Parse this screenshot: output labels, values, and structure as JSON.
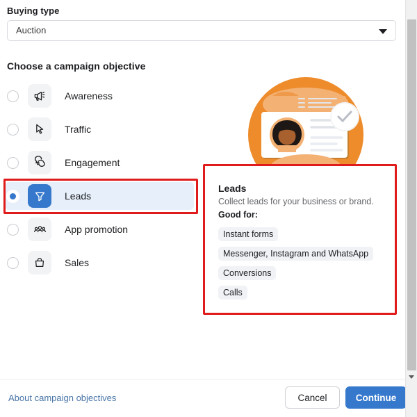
{
  "buying_type": {
    "label": "Buying type",
    "selected_value": "Auction",
    "caret_icon": "chevron-down-icon"
  },
  "section": {
    "title": "Choose a campaign objective"
  },
  "objectives": [
    {
      "id": "awareness",
      "label": "Awareness",
      "icon": "megaphone-icon",
      "selected": false
    },
    {
      "id": "traffic",
      "label": "Traffic",
      "icon": "cursor-arrow-icon",
      "selected": false
    },
    {
      "id": "engagement",
      "label": "Engagement",
      "icon": "chat-bubbles-icon",
      "selected": false
    },
    {
      "id": "leads",
      "label": "Leads",
      "icon": "funnel-icon",
      "selected": true
    },
    {
      "id": "app-promotion",
      "label": "App promotion",
      "icon": "people-group-icon",
      "selected": false
    },
    {
      "id": "sales",
      "label": "Sales",
      "icon": "shopping-bag-icon",
      "selected": false
    }
  ],
  "detail": {
    "title": "Leads",
    "description": "Collect leads for your business or brand.",
    "good_for_label": "Good for:",
    "chips": [
      "Instant forms",
      "Messenger, Instagram and WhatsApp",
      "Conversions",
      "Calls"
    ]
  },
  "illustration": {
    "name": "leads-illustration",
    "circle_color": "#ee8b2a",
    "badge_icon": "check-circle-icon"
  },
  "footer": {
    "about_link": "About campaign objectives",
    "cancel_label": "Cancel",
    "continue_label": "Continue"
  },
  "colors": {
    "accent_blue": "#3578cc",
    "highlight_red": "#e01b1b",
    "selected_row_bg": "#e7f0fa",
    "chip_bg": "#f0f2f5"
  },
  "scrollbar": {
    "down_arrow_icon": "caret-down-icon"
  }
}
